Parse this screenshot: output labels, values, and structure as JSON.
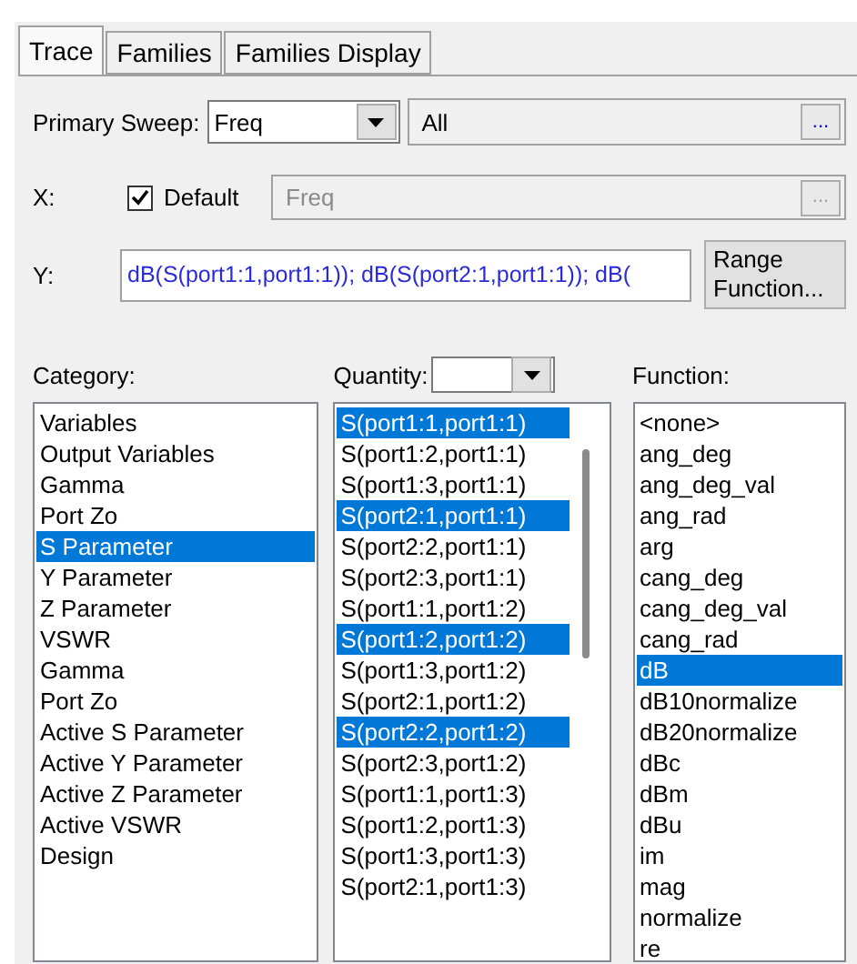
{
  "tabs": [
    {
      "label": "Trace",
      "selected": true
    },
    {
      "label": "Families",
      "selected": false
    },
    {
      "label": "Families Display",
      "selected": false
    }
  ],
  "primary_sweep": {
    "label": "Primary Sweep:",
    "value": "Freq",
    "range": "All",
    "range_button": "..."
  },
  "x": {
    "label": "X:",
    "default_label": "Default",
    "checked": true,
    "value": "Freq",
    "button": "..."
  },
  "y": {
    "label": "Y:",
    "value": "dB(S(port1:1,port1:1)); dB(S(port2:1,port1:1)); dB(",
    "button": "Range Function..."
  },
  "category": {
    "label": "Category:",
    "items": [
      {
        "label": "Variables",
        "selected": false
      },
      {
        "label": "Output Variables",
        "selected": false
      },
      {
        "label": "Gamma",
        "selected": false
      },
      {
        "label": "Port Zo",
        "selected": false
      },
      {
        "label": "S Parameter",
        "selected": true
      },
      {
        "label": "Y Parameter",
        "selected": false
      },
      {
        "label": "Z Parameter",
        "selected": false
      },
      {
        "label": "VSWR",
        "selected": false
      },
      {
        "label": "Gamma",
        "selected": false
      },
      {
        "label": "Port Zo",
        "selected": false
      },
      {
        "label": "Active S Parameter",
        "selected": false
      },
      {
        "label": "Active Y Parameter",
        "selected": false
      },
      {
        "label": "Active Z Parameter",
        "selected": false
      },
      {
        "label": "Active VSWR",
        "selected": false
      },
      {
        "label": "Design",
        "selected": false
      }
    ]
  },
  "quantity": {
    "label": "Quantity:",
    "items": [
      {
        "label": "S(port1:1,port1:1)",
        "selected": true
      },
      {
        "label": "S(port1:2,port1:1)",
        "selected": false
      },
      {
        "label": "S(port1:3,port1:1)",
        "selected": false
      },
      {
        "label": "S(port2:1,port1:1)",
        "selected": true
      },
      {
        "label": "S(port2:2,port1:1)",
        "selected": false
      },
      {
        "label": "S(port2:3,port1:1)",
        "selected": false
      },
      {
        "label": "S(port1:1,port1:2)",
        "selected": false
      },
      {
        "label": "S(port1:2,port1:2)",
        "selected": true
      },
      {
        "label": "S(port1:3,port1:2)",
        "selected": false
      },
      {
        "label": "S(port2:1,port1:2)",
        "selected": false
      },
      {
        "label": "S(port2:2,port1:2)",
        "selected": true
      },
      {
        "label": "S(port2:3,port1:2)",
        "selected": false
      },
      {
        "label": "S(port1:1,port1:3)",
        "selected": false
      },
      {
        "label": "S(port1:2,port1:3)",
        "selected": false
      },
      {
        "label": "S(port1:3,port1:3)",
        "selected": false
      },
      {
        "label": "S(port2:1,port1:3)",
        "selected": false
      }
    ]
  },
  "function": {
    "label": "Function:",
    "items": [
      {
        "label": "<none>",
        "selected": false
      },
      {
        "label": "ang_deg",
        "selected": false
      },
      {
        "label": "ang_deg_val",
        "selected": false
      },
      {
        "label": "ang_rad",
        "selected": false
      },
      {
        "label": "arg",
        "selected": false
      },
      {
        "label": "cang_deg",
        "selected": false
      },
      {
        "label": "cang_deg_val",
        "selected": false
      },
      {
        "label": "cang_rad",
        "selected": false
      },
      {
        "label": "dB",
        "selected": true
      },
      {
        "label": "dB10normalize",
        "selected": false
      },
      {
        "label": "dB20normalize",
        "selected": false
      },
      {
        "label": "dBc",
        "selected": false
      },
      {
        "label": "dBm",
        "selected": false
      },
      {
        "label": "dBu",
        "selected": false
      },
      {
        "label": "im",
        "selected": false
      },
      {
        "label": "mag",
        "selected": false
      },
      {
        "label": "normalize",
        "selected": false
      },
      {
        "label": "re",
        "selected": false
      }
    ]
  }
}
